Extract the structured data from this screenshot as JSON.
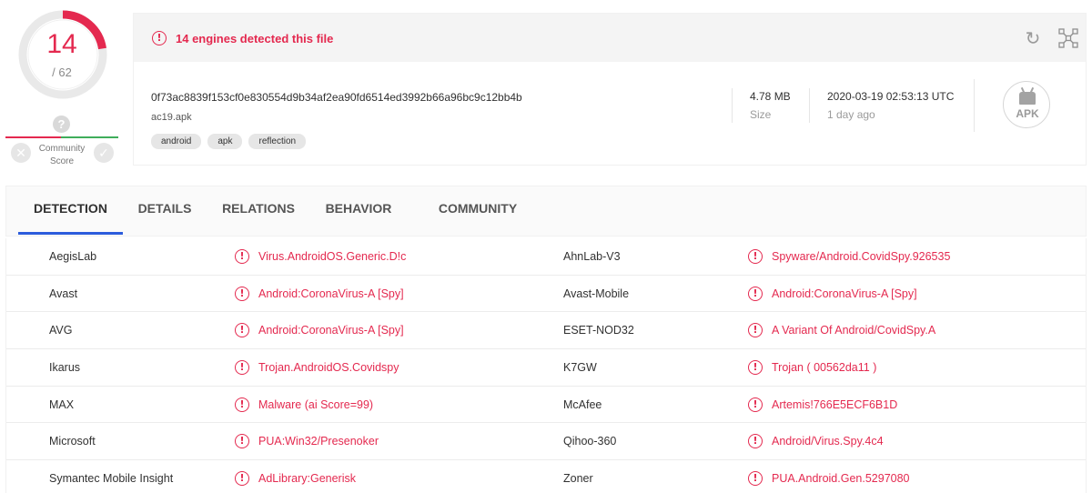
{
  "score": {
    "detections": "14",
    "total": "/ 62",
    "detected_fraction": 0.2258,
    "community_label": "Community\nScore",
    "question_icon": "question-icon",
    "vote_down_icon": "close-icon",
    "vote_up_icon": "check-icon"
  },
  "colors": {
    "accent_red": "#e4294f",
    "tab_underline": "#2c5cdc",
    "community_green": "#3fad5b"
  },
  "banner": {
    "text": "14 engines detected this file",
    "reanalyze_icon": "refresh-icon",
    "graph_icon": "graph-icon"
  },
  "file": {
    "hash": "0f73ac8839f153cf0e830554d9b34af2ea90fd6514ed3992b66a96bc9c12bb4b",
    "name": "ac19.apk",
    "tags": [
      "android",
      "apk",
      "reflection"
    ],
    "size_value": "4.78 MB",
    "size_label": "Size",
    "date_value": "2020-03-19 02:53:13 UTC",
    "date_label": "1 day ago",
    "type_badge": "APK"
  },
  "tabs": [
    {
      "label": "DETECTION",
      "active": true
    },
    {
      "label": "DETAILS",
      "active": false
    },
    {
      "label": "RELATIONS",
      "active": false
    },
    {
      "label": "BEHAVIOR",
      "active": false
    },
    {
      "label": "COMMUNITY",
      "active": false
    }
  ],
  "detections": [
    {
      "engine1": "AegisLab",
      "result1": "Virus.AndroidOS.Generic.D!c",
      "engine2": "AhnLab-V3",
      "result2": "Spyware/Android.CovidSpy.926535"
    },
    {
      "engine1": "Avast",
      "result1": "Android:CoronaVirus-A [Spy]",
      "engine2": "Avast-Mobile",
      "result2": "Android:CoronaVirus-A [Spy]"
    },
    {
      "engine1": "AVG",
      "result1": "Android:CoronaVirus-A [Spy]",
      "engine2": "ESET-NOD32",
      "result2": "A Variant Of Android/CovidSpy.A"
    },
    {
      "engine1": "Ikarus",
      "result1": "Trojan.AndroidOS.Covidspy",
      "engine2": "K7GW",
      "result2": "Trojan ( 00562da11 )"
    },
    {
      "engine1": "MAX",
      "result1": "Malware (ai Score=99)",
      "engine2": "McAfee",
      "result2": "Artemis!766E5ECF6B1D"
    },
    {
      "engine1": "Microsoft",
      "result1": "PUA:Win32/Presenoker",
      "engine2": "Qihoo-360",
      "result2": "Android/Virus.Spy.4c4"
    },
    {
      "engine1": "Symantec Mobile Insight",
      "result1": "AdLibrary:Generisk",
      "engine2": "Zoner",
      "result2": "PUA.Android.Gen.5297080"
    }
  ]
}
